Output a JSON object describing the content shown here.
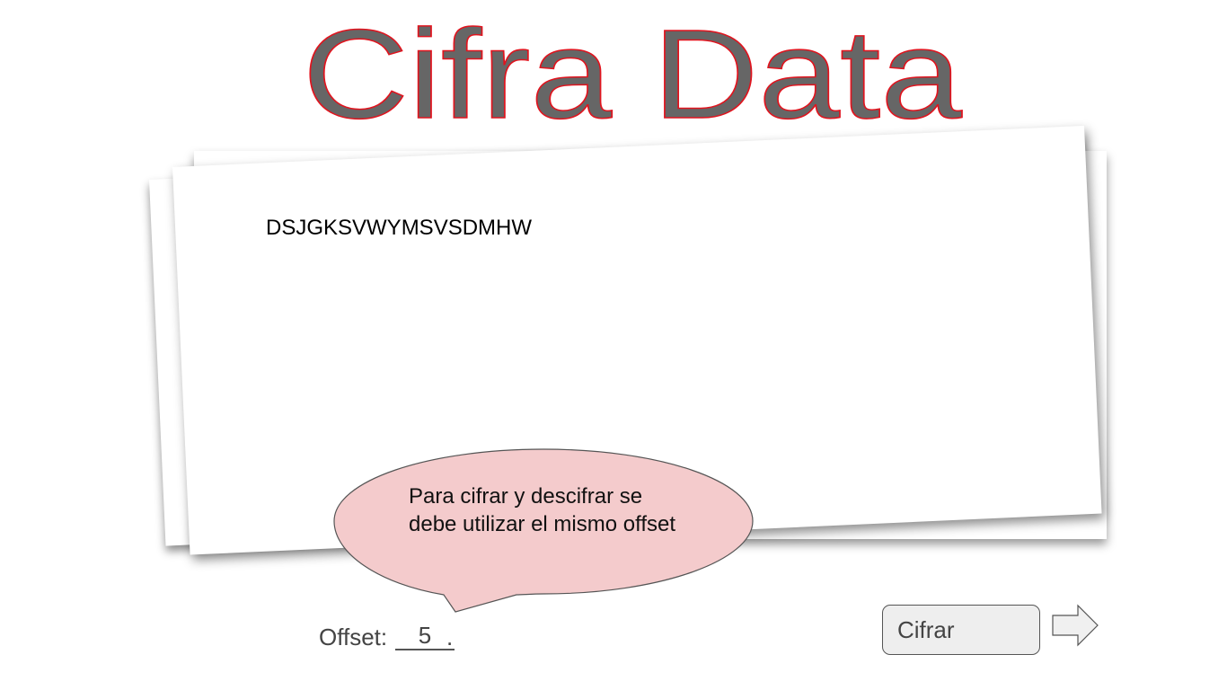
{
  "app": {
    "title": "Cifra Data"
  },
  "document": {
    "cipher_text": "DSJGKSVWYMSVSDMHW"
  },
  "tooltip": {
    "text": "Para cifrar y descifrar se debe utilizar el mismo offset"
  },
  "controls": {
    "offset_label": "Offset:",
    "offset_value": "5",
    "offset_suffix": ".",
    "cipher_button_label": "Cifrar"
  },
  "colors": {
    "title_fill": "#666666",
    "title_stroke": "#e0141e",
    "bubble_fill": "#f4cbcc",
    "button_bg": "#eeeeee"
  },
  "icons": {
    "next": "arrow-right-icon"
  }
}
